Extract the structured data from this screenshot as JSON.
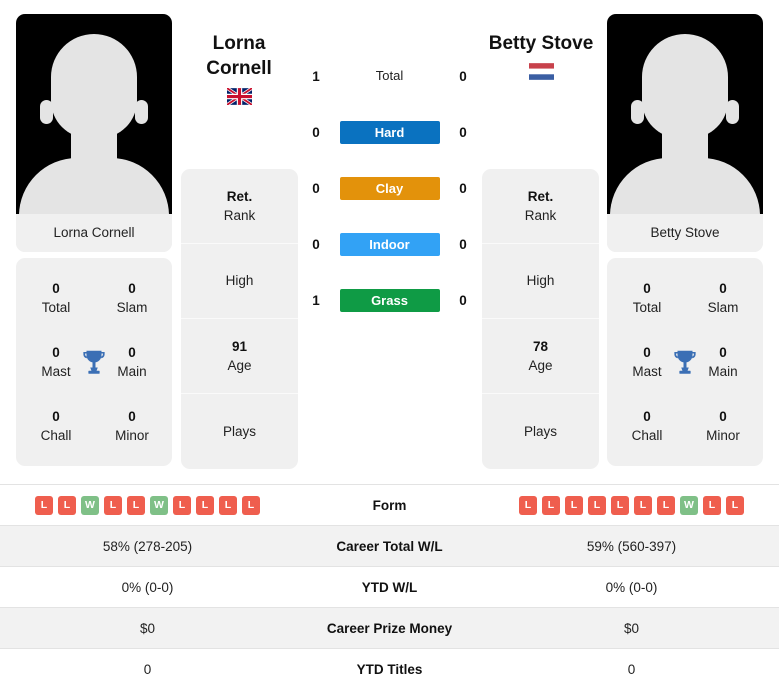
{
  "colors": {
    "hard": "#0a72c0",
    "clay": "#e3920b",
    "indoor": "#32a2f5",
    "grass": "#0f9b45",
    "win": "#7fc087",
    "loss": "#ef5e4e",
    "trophy": "#3b6fb5"
  },
  "players": {
    "left": {
      "name": "Lorna Cornell",
      "name_line1": "Lorna",
      "name_line2": "Cornell",
      "photo_caption": "Lorna Cornell",
      "flag": "united-kingdom-flag",
      "titles": {
        "total_value": "0",
        "total_label": "Total",
        "slam_value": "0",
        "slam_label": "Slam",
        "mast_value": "0",
        "mast_label": "Mast",
        "main_value": "0",
        "main_label": "Main",
        "chall_value": "0",
        "chall_label": "Chall",
        "minor_value": "0",
        "minor_label": "Minor"
      },
      "info": {
        "rank_value": "Ret.",
        "rank_label": "Rank",
        "high_value": "",
        "high_label": "High",
        "age_value": "91",
        "age_label": "Age",
        "plays_value": "",
        "plays_label": "Plays"
      },
      "form": [
        "L",
        "L",
        "W",
        "L",
        "L",
        "W",
        "L",
        "L",
        "L",
        "L"
      ],
      "career_total_wl": "58% (278-205)",
      "ytd_wl": "0% (0-0)",
      "career_prize_money": "$0",
      "ytd_titles": "0"
    },
    "right": {
      "name": "Betty Stove",
      "name_line1": "Betty Stove",
      "name_line2": "",
      "photo_caption": "Betty Stove",
      "flag": "netherlands-flag",
      "titles": {
        "total_value": "0",
        "total_label": "Total",
        "slam_value": "0",
        "slam_label": "Slam",
        "mast_value": "0",
        "mast_label": "Mast",
        "main_value": "0",
        "main_label": "Main",
        "chall_value": "0",
        "chall_label": "Chall",
        "minor_value": "0",
        "minor_label": "Minor"
      },
      "info": {
        "rank_value": "Ret.",
        "rank_label": "Rank",
        "high_value": "",
        "high_label": "High",
        "age_value": "78",
        "age_label": "Age",
        "plays_value": "",
        "plays_label": "Plays"
      },
      "form": [
        "L",
        "L",
        "L",
        "L",
        "L",
        "L",
        "L",
        "W",
        "L",
        "L"
      ],
      "career_total_wl": "59% (560-397)",
      "ytd_wl": "0% (0-0)",
      "career_prize_money": "$0",
      "ytd_titles": "0"
    }
  },
  "h2h": {
    "total": {
      "label": "Total",
      "left": "1",
      "right": "0"
    },
    "surfaces": [
      {
        "label": "Hard",
        "left": "0",
        "right": "0",
        "color": "#0a72c0"
      },
      {
        "label": "Clay",
        "left": "0",
        "right": "0",
        "color": "#e3920b"
      },
      {
        "label": "Indoor",
        "left": "0",
        "right": "0",
        "color": "#32a2f5"
      },
      {
        "label": "Grass",
        "left": "1",
        "right": "0",
        "color": "#0f9b45"
      }
    ]
  },
  "table": {
    "rows": [
      {
        "label": "Form",
        "type": "form"
      },
      {
        "label": "Career Total W/L",
        "type": "text",
        "key": "career_total_wl"
      },
      {
        "label": "YTD W/L",
        "type": "text",
        "key": "ytd_wl"
      },
      {
        "label": "Career Prize Money",
        "type": "text",
        "key": "career_prize_money"
      },
      {
        "label": "YTD Titles",
        "type": "text",
        "key": "ytd_titles"
      }
    ]
  }
}
